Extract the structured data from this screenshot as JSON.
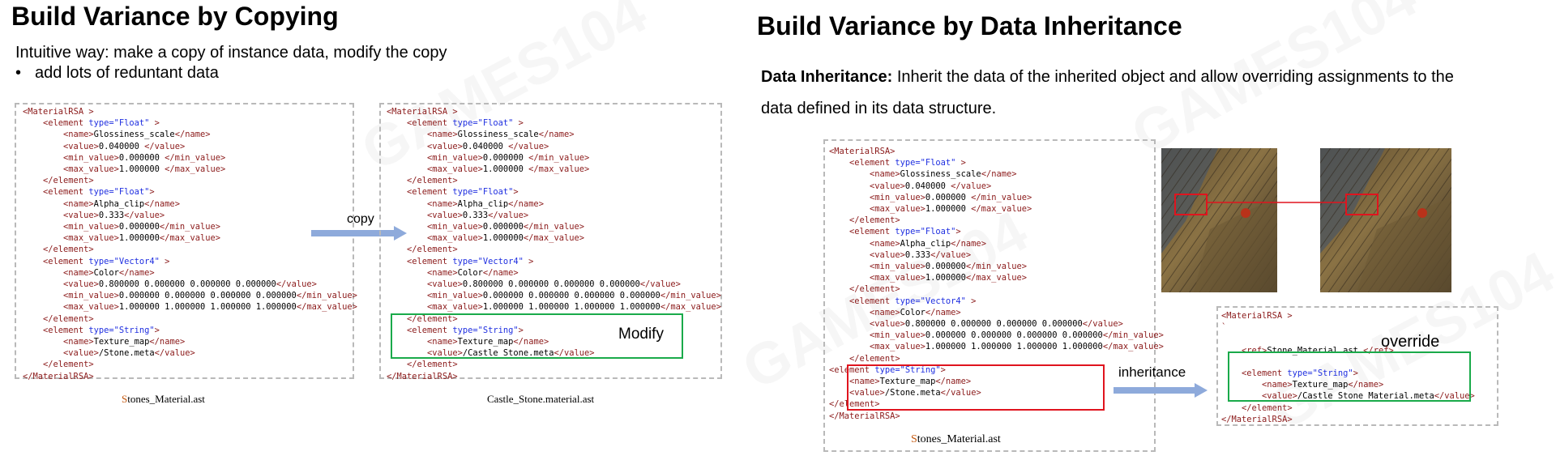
{
  "watermark": "GAMES104",
  "left": {
    "title": "Build Variance by Copying",
    "intro": "Intuitive way: make a copy of instance data, modify the copy",
    "bullet_marker": "•",
    "bullet": "add lots of reduntant data",
    "arrow_label": "copy",
    "modify_label": "Modify",
    "caption_left_initial": "S",
    "caption_left_rest": "tones_Material.ast",
    "caption_right": "Castle_Stone.material.ast",
    "xml_left": {
      "root_open": "MaterialRSA",
      "root_close": "MaterialRSA",
      "elements": [
        {
          "type": "\"Float\"",
          "name": "Glossiness_scale",
          "value": "0.040000 ",
          "min": "0.000000 ",
          "max": "1.000000 "
        },
        {
          "type": "\"Float\"",
          "name": "Alpha_clip",
          "value": "0.333",
          "min": "0.000000",
          "max": "1.000000"
        },
        {
          "type": "\"Vector4\"",
          "name": "Color",
          "value": "0.800000 0.000000 0.000000 0.000000",
          "min": "0.000000 0.000000 0.000000 0.000000",
          "max": "1.000000 1.000000 1.000000 1.000000"
        },
        {
          "type": "\"String\"",
          "name": "Texture_map",
          "value": "/Stone.meta"
        }
      ]
    },
    "xml_right": {
      "root_open": "MaterialRSA",
      "root_close": "MaterialRSA",
      "elements": [
        {
          "type": "\"Float\"",
          "name": "Glossiness_scale",
          "value": "0.040000 ",
          "min": "0.000000 ",
          "max": "1.000000 "
        },
        {
          "type": "\"Float\"",
          "name": "Alpha_clip",
          "value": "0.333",
          "min": "0.000000",
          "max": "1.000000"
        },
        {
          "type": "\"Vector4\"",
          "name": "Color",
          "value": "0.800000 0.000000 0.000000 0.000000",
          "min": "0.000000 0.000000 0.000000 0.000000",
          "max": "1.000000 1.000000 1.000000 1.000000"
        },
        {
          "type": "\"String\"",
          "name": "Texture_map",
          "value": "/Castle_Stone.meta"
        }
      ]
    }
  },
  "right": {
    "title": "Build Variance by Data Inheritance",
    "def_bold": "Data Inheritance:",
    "def_text_1": " Inherit the data of the inherited object and allow overriding assignments to the",
    "def_text_2": "data defined in its data structure.",
    "arrow_label": "inheritance",
    "override_label": "override",
    "caption_initial": "S",
    "caption_rest": "tones_Material.ast",
    "xml_base": {
      "root_open": "MaterialRSA",
      "root_close": "MaterialRSA",
      "elements": [
        {
          "type": "\"Float\"",
          "name": "Glossiness_scale",
          "value": "0.040000 ",
          "min": "0.000000 ",
          "max": "1.000000 "
        },
        {
          "type": "\"Float\"",
          "name": "Alpha_clip",
          "value": "0.333",
          "min": "0.000000",
          "max": "1.000000"
        },
        {
          "type": "\"Vector4\"",
          "name": "Color",
          "value": "0.800000 0.000000 0.000000 0.000000",
          "min": "0.000000 0.000000 0.000000 0.000000",
          "max": "1.000000 1.000000 1.000000 1.000000"
        },
        {
          "type": "\"String\"",
          "name": "Texture_map",
          "value": "/Stone.meta"
        }
      ]
    },
    "xml_override": {
      "root_open": "MaterialRSA",
      "ref_value": "Stone_Material.ast ",
      "ref_tag": "ref",
      "element_type": "\"String\"",
      "element_name": "Texture_map",
      "element_value": "/Castle_Stone_Material.meta",
      "root_close": "MaterialRSA"
    }
  },
  "colors": {
    "tag": "#8b1a1a",
    "attr": "#1f2fe0",
    "arrow": "#8eaadb",
    "green": "#1aaa4a",
    "red": "#e0141e",
    "caption_initial": "#c55a11"
  }
}
